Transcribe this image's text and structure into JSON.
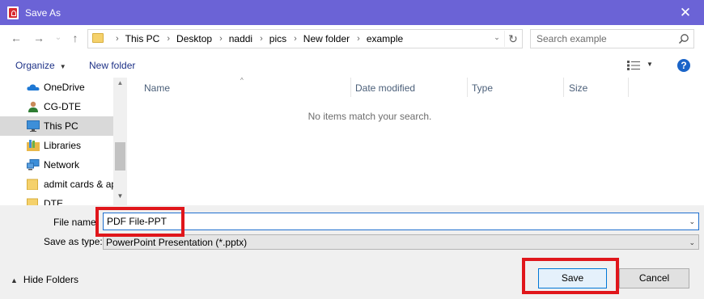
{
  "window": {
    "title": "Save As",
    "close_glyph": "✕",
    "icon": "acrobat-pdf-icon"
  },
  "navigation": {
    "back_glyph": "←",
    "forward_glyph": "→",
    "recent_glyph": "⌄",
    "up_glyph": "↑",
    "breadcrumbs": [
      "This PC",
      "Desktop",
      "naddi",
      "pics",
      "New folder",
      "example"
    ],
    "separator": "›",
    "dropdown_glyph": "⌄",
    "refresh_glyph": "↻",
    "search_placeholder": "Search example"
  },
  "toolbar": {
    "organize_label": "Organize",
    "new_folder_label": "New folder",
    "help_label": "?"
  },
  "sidebar": {
    "items": [
      {
        "label": "OneDrive",
        "icon": "cloud-icon"
      },
      {
        "label": "CG-DTE",
        "icon": "user-icon"
      },
      {
        "label": "This PC",
        "icon": "monitor-icon",
        "selected": true
      },
      {
        "label": "Libraries",
        "icon": "libraries-icon"
      },
      {
        "label": "Network",
        "icon": "network-icon"
      },
      {
        "label": "admit cards & ap",
        "icon": "folder-icon"
      },
      {
        "label": "DTE",
        "icon": "folder-icon"
      }
    ]
  },
  "file_list": {
    "columns": [
      "Name",
      "Date modified",
      "Type",
      "Size"
    ],
    "sorted_column": "Name",
    "empty_message": "No items match your search."
  },
  "form": {
    "file_name_label": "File name:",
    "file_name_value": "PDF File-PPT",
    "save_type_label": "Save as type:",
    "save_type_value": "PowerPoint Presentation (*.pptx)"
  },
  "footer": {
    "hide_folders_label": "Hide Folders",
    "save_label": "Save",
    "cancel_label": "Cancel"
  },
  "colors": {
    "titlebar": "#6b63d6",
    "accent": "#0078d7",
    "highlight": "#e0161b",
    "link_text": "#1e3287"
  }
}
